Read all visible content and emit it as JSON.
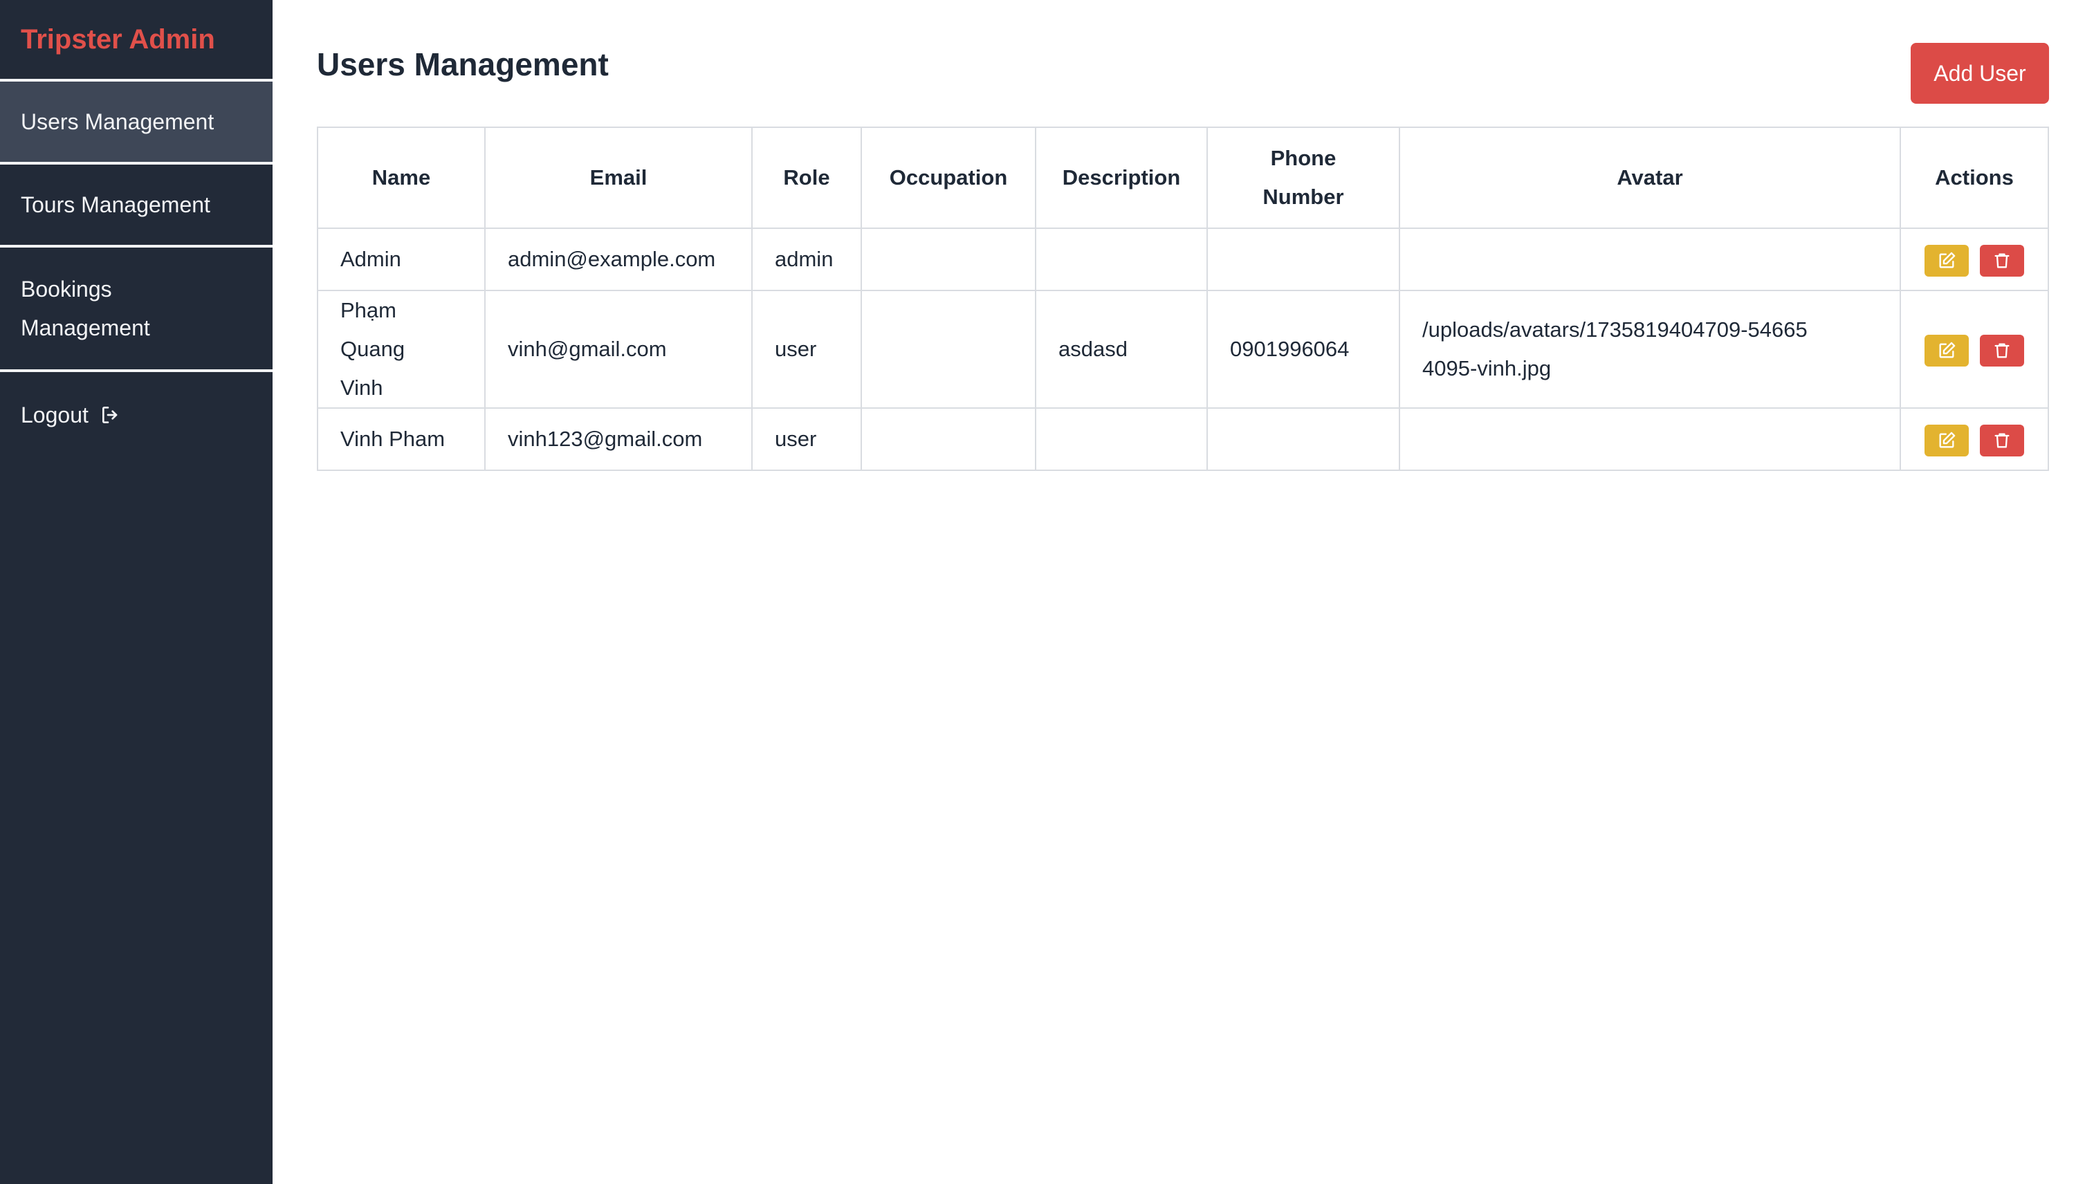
{
  "sidebar": {
    "brand": "Tripster Admin",
    "items": [
      {
        "label": "Users Management",
        "icon": null,
        "active": true
      },
      {
        "label": "Tours Management",
        "icon": null,
        "active": false
      },
      {
        "label": "Bookings Management",
        "icon": null,
        "active": false
      },
      {
        "label": "Logout",
        "icon": "logout-icon",
        "active": false
      }
    ]
  },
  "main": {
    "title": "Users Management",
    "add_button": "Add User"
  },
  "table": {
    "headers": [
      "Name",
      "Email",
      "Role",
      "Occupation",
      "Description",
      "Phone Number",
      "Avatar",
      "Actions"
    ],
    "rows": [
      {
        "name": "Admin",
        "email": "admin@example.com",
        "role": "admin",
        "occupation": "",
        "description": "",
        "phone": "",
        "avatar": ""
      },
      {
        "name": "Phạm Quang Vinh",
        "email": "vinh@gmail.com",
        "role": "user",
        "occupation": "",
        "description": "asdasd",
        "phone": "0901996064",
        "avatar": "/uploads/avatars/1735819404709-546654095-vinh.jpg"
      },
      {
        "name": "Vinh Pham",
        "email": "vinh123@gmail.com",
        "role": "user",
        "occupation": "",
        "description": "",
        "phone": "",
        "avatar": ""
      }
    ]
  },
  "colors": {
    "sidebar_bg": "#222a38",
    "sidebar_active": "#3e4757",
    "brand": "#e0504a",
    "danger": "#dc4b47",
    "warning": "#e3b32f"
  }
}
